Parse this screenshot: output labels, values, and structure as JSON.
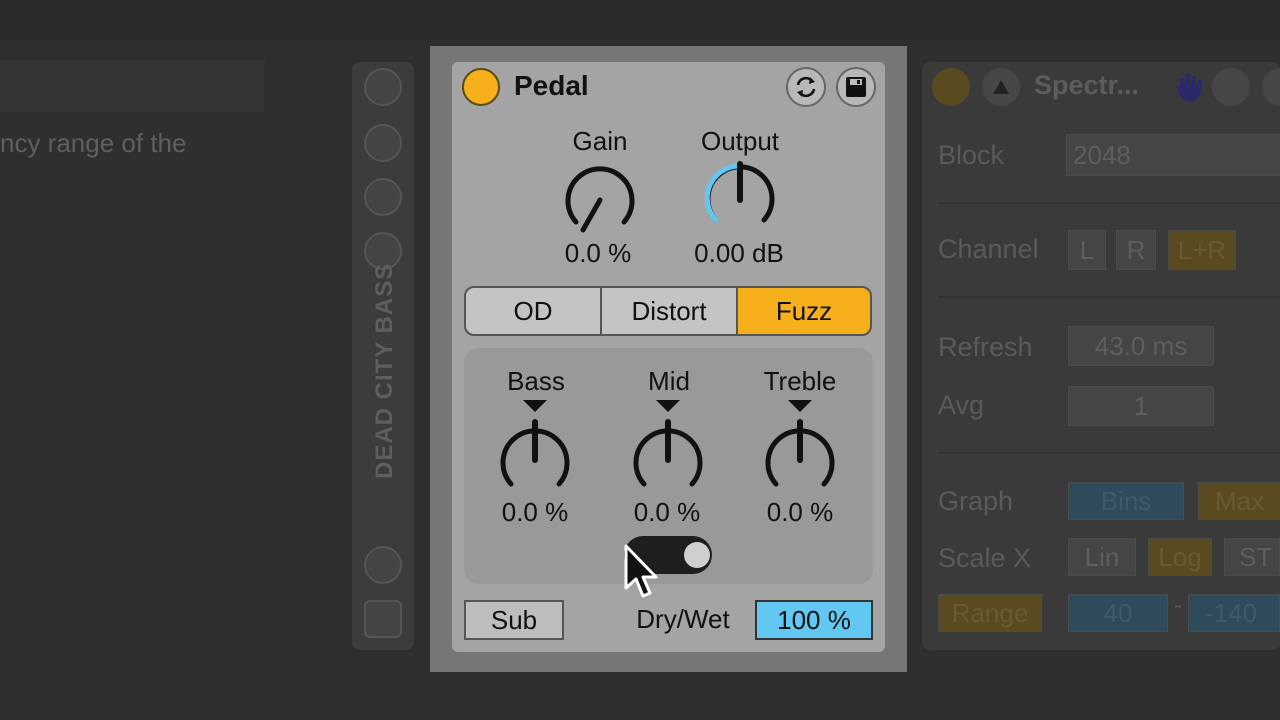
{
  "background": {
    "left_text": "ncy range of the",
    "track_name": "DEAD CITY BASS"
  },
  "spectrum": {
    "title": "Spectr...",
    "block_label": "Block",
    "block_value": "2048",
    "channel_label": "Channel",
    "channel_options": [
      "L",
      "R",
      "L+R"
    ],
    "refresh_label": "Refresh",
    "refresh_value": "43.0 ms",
    "avg_label": "Avg",
    "avg_value": "1",
    "graph_label": "Graph",
    "graph_options": [
      "Bins",
      "Max"
    ],
    "scalex_label": "Scale X",
    "scalex_options": [
      "Lin",
      "Log",
      "ST"
    ],
    "range_label": "Range",
    "range_min": "40",
    "range_sep": "-",
    "range_max": "-140"
  },
  "pedal": {
    "title": "Pedal",
    "accent_color": "#f6b01c",
    "highlight_color": "#62c7f1",
    "gain": {
      "label": "Gain",
      "value": "0.0 %"
    },
    "output": {
      "label": "Output",
      "value": "0.00 dB"
    },
    "modes": [
      "OD",
      "Distort",
      "Fuzz"
    ],
    "selected_mode": "Fuzz",
    "eq": [
      {
        "label": "Bass",
        "value": "0.0 %"
      },
      {
        "label": "Mid",
        "value": "0.0 %"
      },
      {
        "label": "Treble",
        "value": "0.0 %"
      }
    ],
    "sub_label": "Sub",
    "drywet_label": "Dry/Wet",
    "drywet_value": "100 %"
  }
}
